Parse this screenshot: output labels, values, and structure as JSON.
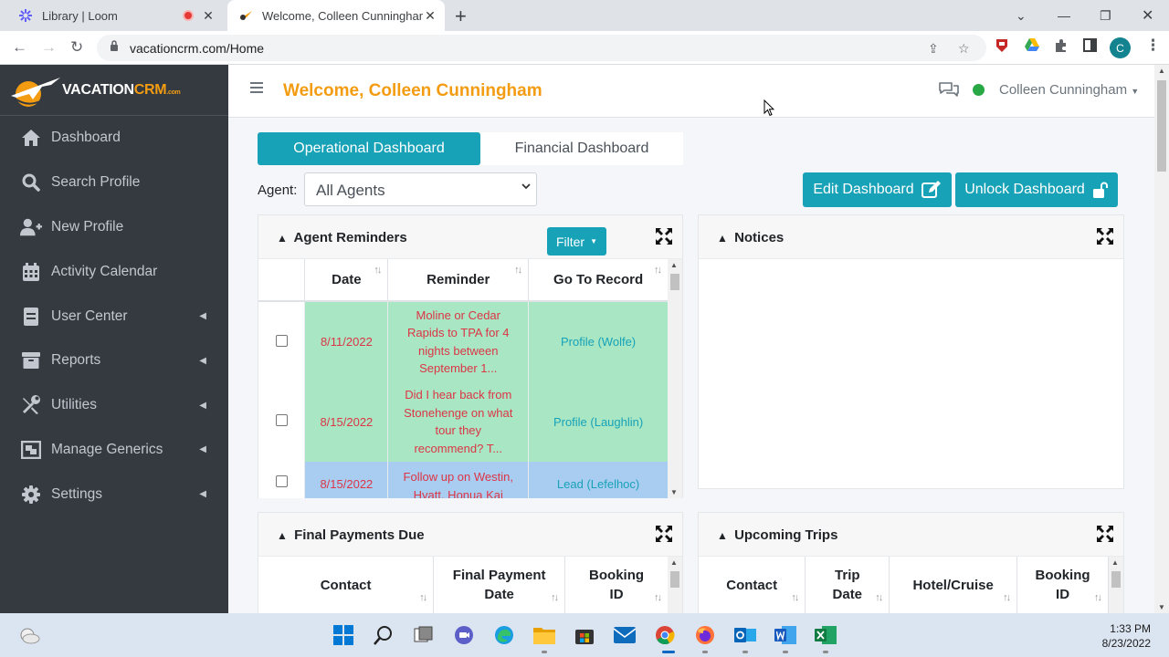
{
  "browser": {
    "tabs": [
      {
        "title": "Library | Loom",
        "recording": true
      },
      {
        "title": "Welcome, Colleen Cunningham",
        "active": true
      }
    ],
    "url": "vacationcrm.com/Home",
    "profile_initial": "C"
  },
  "sidebar": {
    "logo_text_a": "VACATION",
    "logo_text_b": "CRM",
    "logo_text_c": ".com",
    "items": [
      {
        "label": "Dashboard",
        "icon": "home-icon",
        "has_submenu": false
      },
      {
        "label": "Search Profile",
        "icon": "search-icon",
        "has_submenu": false
      },
      {
        "label": "New Profile",
        "icon": "user-plus-icon",
        "has_submenu": false
      },
      {
        "label": "Activity Calendar",
        "icon": "calendar-icon",
        "has_submenu": false
      },
      {
        "label": "User Center",
        "icon": "address-book-icon",
        "has_submenu": true
      },
      {
        "label": "Reports",
        "icon": "archive-icon",
        "has_submenu": true
      },
      {
        "label": "Utilities",
        "icon": "tools-icon",
        "has_submenu": true
      },
      {
        "label": "Manage Generics",
        "icon": "object-group-icon",
        "has_submenu": true
      },
      {
        "label": "Settings",
        "icon": "gear-icon",
        "has_submenu": true
      }
    ]
  },
  "header": {
    "welcome": "Welcome, Colleen Cunningham",
    "user_name": "Colleen Cunningham",
    "status_color": "#28a745"
  },
  "dashboard": {
    "tabs": [
      "Operational Dashboard",
      "Financial Dashboard"
    ],
    "agent_label": "Agent:",
    "agent_value": "All Agents",
    "edit_button": "Edit Dashboard",
    "unlock_button": "Unlock Dashboard",
    "accent": "#17a2b8"
  },
  "agent_reminders": {
    "title": "Agent Reminders",
    "filter_label": "Filter",
    "columns": [
      "Date",
      "Reminder",
      "Go To Record"
    ],
    "rows": [
      {
        "date": "8/11/2022",
        "reminder_lines": [
          "Moline or Cedar",
          "Rapids to TPA for 4",
          "nights between",
          "September 1..."
        ],
        "record": "Profile (Wolfe)",
        "color": "#a8e6c4"
      },
      {
        "date": "8/15/2022",
        "reminder_lines": [
          "Did I hear back from",
          "Stonehenge on what",
          "tour they",
          "recommend? T..."
        ],
        "record": "Profile (Laughlin)",
        "color": "#a8e6c4"
      },
      {
        "date": "8/15/2022",
        "reminder_lines": [
          "Follow up on Westin,",
          "Hyatt, Honua Kai"
        ],
        "record": "Lead (Lefelhoc)",
        "color": "#a9cdf1"
      }
    ]
  },
  "notices": {
    "title": "Notices"
  },
  "final_payments": {
    "title": "Final Payments Due",
    "columns": [
      [
        "Contact"
      ],
      [
        "Final Payment",
        "Date"
      ],
      [
        "Booking",
        "ID"
      ]
    ]
  },
  "upcoming_trips": {
    "title": "Upcoming Trips",
    "columns": [
      [
        "Contact"
      ],
      [
        "Trip",
        "Date"
      ],
      [
        "Hotel/Cruise"
      ],
      [
        "Booking",
        "ID"
      ]
    ]
  },
  "taskbar": {
    "time": "1:33 PM",
    "date": "8/23/2022"
  }
}
